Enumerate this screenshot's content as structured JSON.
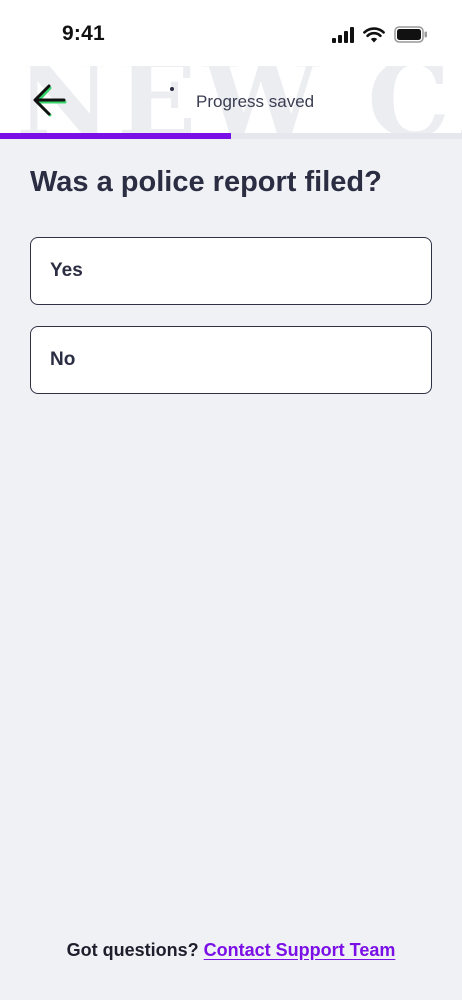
{
  "status_bar": {
    "time": "9:41",
    "icons": [
      "cellular-signal-icon",
      "wifi-icon",
      "battery-icon"
    ]
  },
  "header": {
    "watermark": "NEW CL",
    "back_icon": "arrow-left-icon",
    "progress_text": "Progress saved",
    "progress_fraction": 0.5
  },
  "question": {
    "title": "Was a police report filed?",
    "options": [
      "Yes",
      "No"
    ]
  },
  "footer": {
    "prompt": "Got questions?",
    "link_label": "Contact Support Team"
  },
  "colors": {
    "accent": "#7a0fe6",
    "background": "#f0f1f5",
    "text": "#2b2d42",
    "back_arrow_accent": "#38d66b"
  }
}
